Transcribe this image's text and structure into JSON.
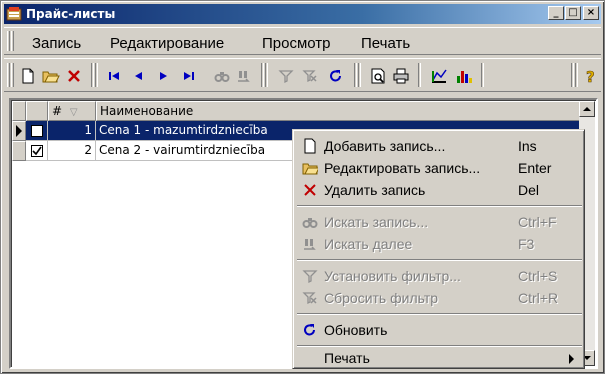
{
  "window": {
    "title": "Прайс-листы",
    "minimize": "_",
    "maximize": "□",
    "close": "×"
  },
  "menubar": {
    "items": [
      {
        "label": "Запись"
      },
      {
        "label": "Редактирование"
      },
      {
        "label": "Просмотр"
      },
      {
        "label": "Печать"
      }
    ]
  },
  "toolbar": {
    "buttons": [
      {
        "icon": "new-document-icon"
      },
      {
        "icon": "open-folder-icon"
      },
      {
        "icon": "delete-icon"
      },
      {
        "icon": "first-record-icon"
      },
      {
        "icon": "prev-record-icon"
      },
      {
        "icon": "next-record-icon"
      },
      {
        "icon": "last-record-icon"
      },
      {
        "icon": "find-icon"
      },
      {
        "icon": "find-next-icon"
      },
      {
        "icon": "filter-icon"
      },
      {
        "icon": "clear-filter-icon"
      },
      {
        "icon": "refresh-icon"
      },
      {
        "icon": "print-preview-icon"
      },
      {
        "icon": "print-icon"
      },
      {
        "icon": "report-icon"
      },
      {
        "icon": "chart-icon"
      },
      {
        "icon": "help-icon"
      }
    ]
  },
  "grid": {
    "columns": [
      "#",
      "Наименование"
    ],
    "rows": [
      {
        "num": "1",
        "name": "Cena 1 - mazumtirdzniecība",
        "checked": false,
        "selected": true
      },
      {
        "num": "2",
        "name": "Cena 2 - vairumtirdzniecība",
        "checked": true,
        "selected": false
      }
    ]
  },
  "context_menu": {
    "items": [
      {
        "label": "Добавить запись...",
        "shortcut": "Ins"
      },
      {
        "label": "Редактировать запись...",
        "shortcut": "Enter"
      },
      {
        "label": "Удалить запись",
        "shortcut": "Del"
      },
      {
        "label": "Искать запись...",
        "shortcut": "Ctrl+F"
      },
      {
        "label": "Искать далее",
        "shortcut": "F3"
      },
      {
        "label": "Установить фильтр...",
        "shortcut": "Ctrl+S"
      },
      {
        "label": "Сбросить фильтр",
        "shortcut": "Ctrl+R"
      },
      {
        "label": "Обновить",
        "shortcut": ""
      },
      {
        "label": "Печать",
        "shortcut": ""
      }
    ]
  }
}
